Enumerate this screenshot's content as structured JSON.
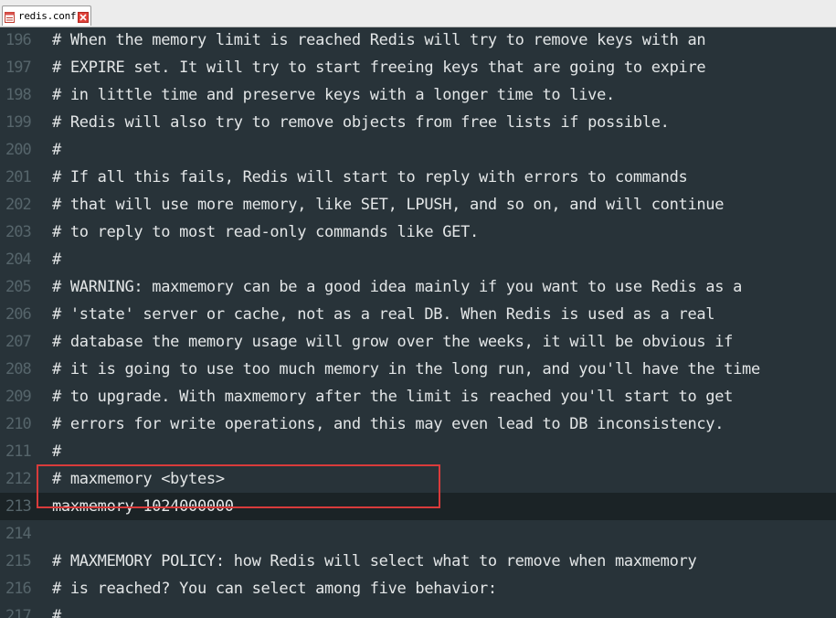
{
  "tab": {
    "label": "redis.conf"
  },
  "lines": [
    {
      "num": "196",
      "text": "# When the memory limit is reached Redis will try to remove keys with an"
    },
    {
      "num": "197",
      "text": "# EXPIRE set. It will try to start freeing keys that are going to expire"
    },
    {
      "num": "198",
      "text": "# in little time and preserve keys with a longer time to live."
    },
    {
      "num": "199",
      "text": "# Redis will also try to remove objects from free lists if possible."
    },
    {
      "num": "200",
      "text": "#"
    },
    {
      "num": "201",
      "text": "# If all this fails, Redis will start to reply with errors to commands"
    },
    {
      "num": "202",
      "text": "# that will use more memory, like SET, LPUSH, and so on, and will continue"
    },
    {
      "num": "203",
      "text": "# to reply to most read-only commands like GET."
    },
    {
      "num": "204",
      "text": "#"
    },
    {
      "num": "205",
      "text": "# WARNING: maxmemory can be a good idea mainly if you want to use Redis as a"
    },
    {
      "num": "206",
      "text": "# 'state' server or cache, not as a real DB. When Redis is used as a real"
    },
    {
      "num": "207",
      "text": "# database the memory usage will grow over the weeks, it will be obvious if"
    },
    {
      "num": "208",
      "text": "# it is going to use too much memory in the long run, and you'll have the time"
    },
    {
      "num": "209",
      "text": "# to upgrade. With maxmemory after the limit is reached you'll start to get"
    },
    {
      "num": "210",
      "text": "# errors for write operations, and this may even lead to DB inconsistency."
    },
    {
      "num": "211",
      "text": "#"
    },
    {
      "num": "212",
      "text": "# maxmemory <bytes>"
    },
    {
      "num": "213",
      "text": "maxmemory 1024000000"
    },
    {
      "num": "214",
      "text": ""
    },
    {
      "num": "215",
      "text": "# MAXMEMORY POLICY: how Redis will select what to remove when maxmemory"
    },
    {
      "num": "216",
      "text": "# is reached? You can select among five behavior:"
    },
    {
      "num": "217",
      "text": "#"
    }
  ],
  "current_line": "213",
  "colors": {
    "background": "#283339",
    "current_line_bg": "#1b2326",
    "text": "#e3e6e7",
    "gutter_text": "#56656b",
    "highlight_border": "#d93b3b"
  }
}
